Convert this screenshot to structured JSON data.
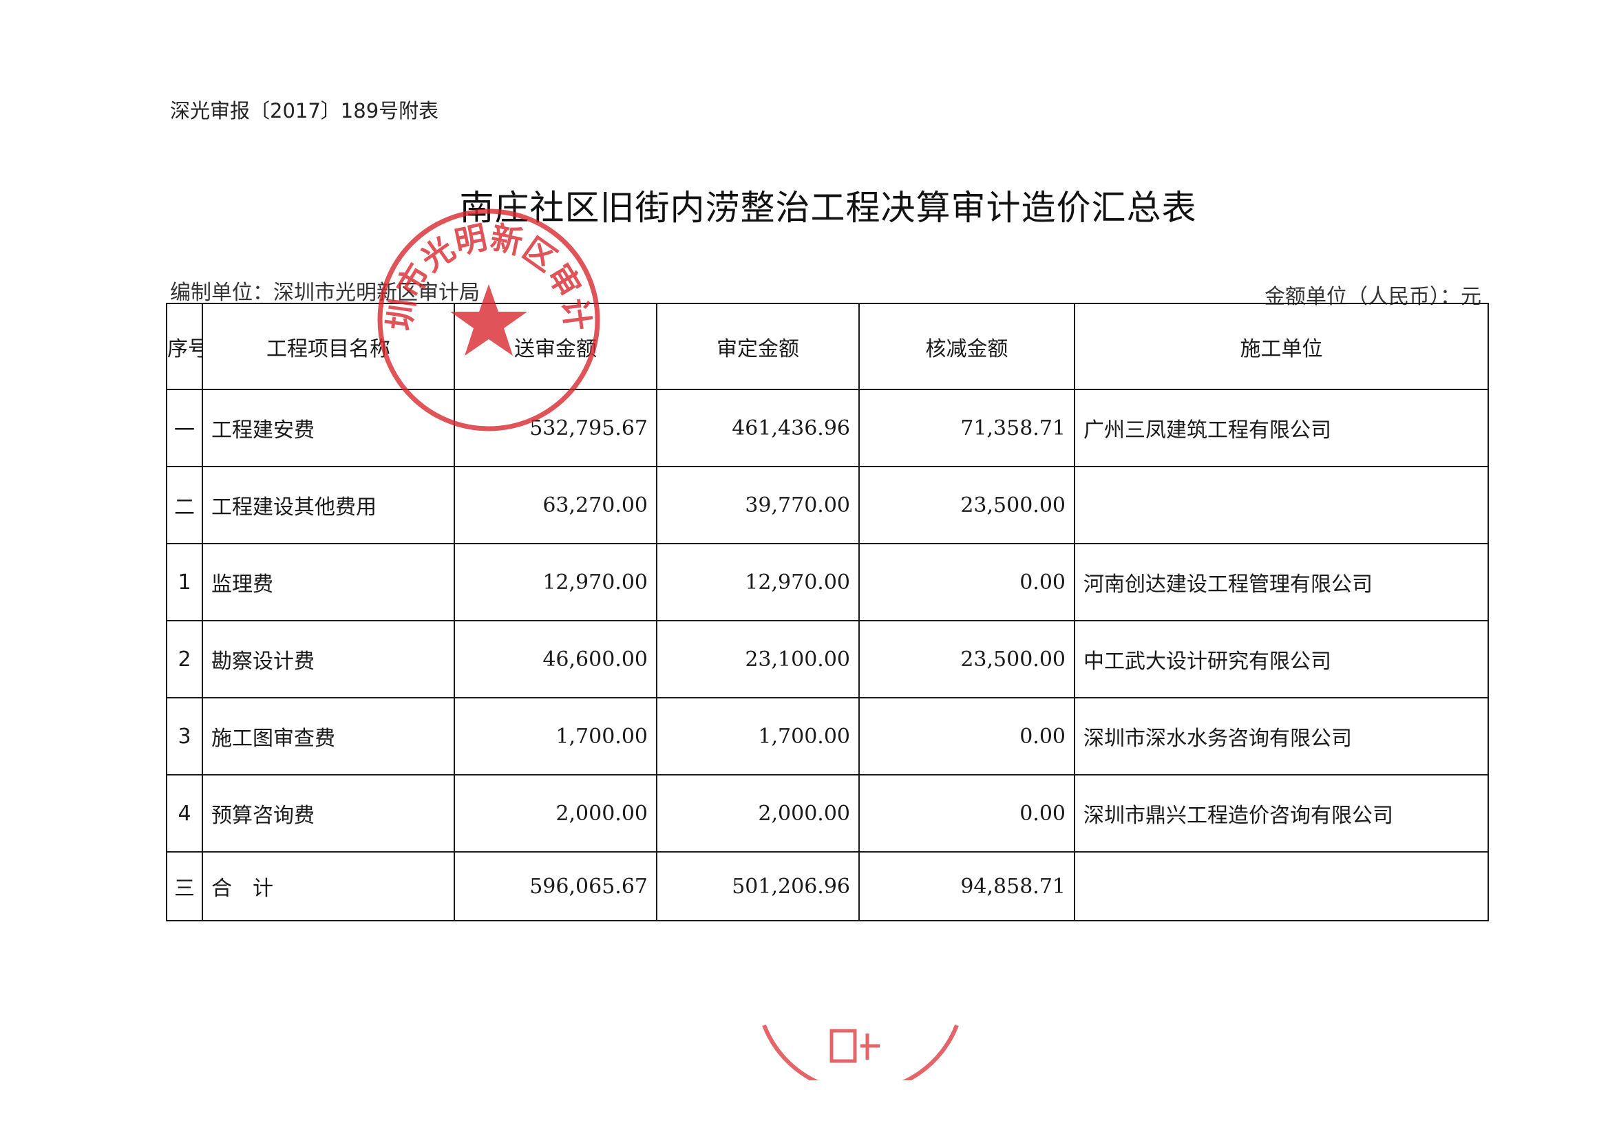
{
  "header": {
    "doc_ref": "深光审报〔2017〕189号附表",
    "title": "南庄社区旧街内涝整治工程决算审计造价汇总表",
    "prepared_by": "编制单位：深圳市光明新区审计局",
    "currency_note": "金额单位（人民币）：元"
  },
  "table": {
    "columns": [
      "序号",
      "工程项目名称",
      "送审金额",
      "审定金额",
      "核减金额",
      "施工单位"
    ],
    "rows": [
      {
        "seq": "一",
        "name": "工程建安费",
        "submitted": "532,795.67",
        "approved": "461,436.96",
        "reduced": "71,358.71",
        "contractor": "广州三凤建筑工程有限公司",
        "bold": true
      },
      {
        "seq": "二",
        "name": "工程建设其他费用",
        "submitted": "63,270.00",
        "approved": "39,770.00",
        "reduced": "23,500.00",
        "contractor": "",
        "bold": true
      },
      {
        "seq": "1",
        "name": "监理费",
        "submitted": "12,970.00",
        "approved": "12,970.00",
        "reduced": "0.00",
        "contractor": "河南创达建设工程管理有限公司",
        "bold": false
      },
      {
        "seq": "2",
        "name": "勘察设计费",
        "submitted": "46,600.00",
        "approved": "23,100.00",
        "reduced": "23,500.00",
        "contractor": "中工武大设计研究有限公司",
        "bold": false
      },
      {
        "seq": "3",
        "name": "施工图审查费",
        "submitted": "1,700.00",
        "approved": "1,700.00",
        "reduced": "0.00",
        "contractor": "深圳市深水水务咨询有限公司",
        "bold": false
      },
      {
        "seq": "4",
        "name": "预算咨询费",
        "submitted": "2,000.00",
        "approved": "2,000.00",
        "reduced": "0.00",
        "contractor": "深圳市鼎兴工程造价咨询有限公司",
        "bold": false
      },
      {
        "seq": "三",
        "name": "合　计",
        "submitted": "596,065.67",
        "approved": "501,206.96",
        "reduced": "94,858.71",
        "contractor": "",
        "bold": true
      }
    ]
  },
  "seal": {
    "text": "深圳市光明新区审计局",
    "color": "#d8252b"
  },
  "colors": {
    "ink": "#1a1a1a",
    "seal_red": "#d8252b"
  }
}
